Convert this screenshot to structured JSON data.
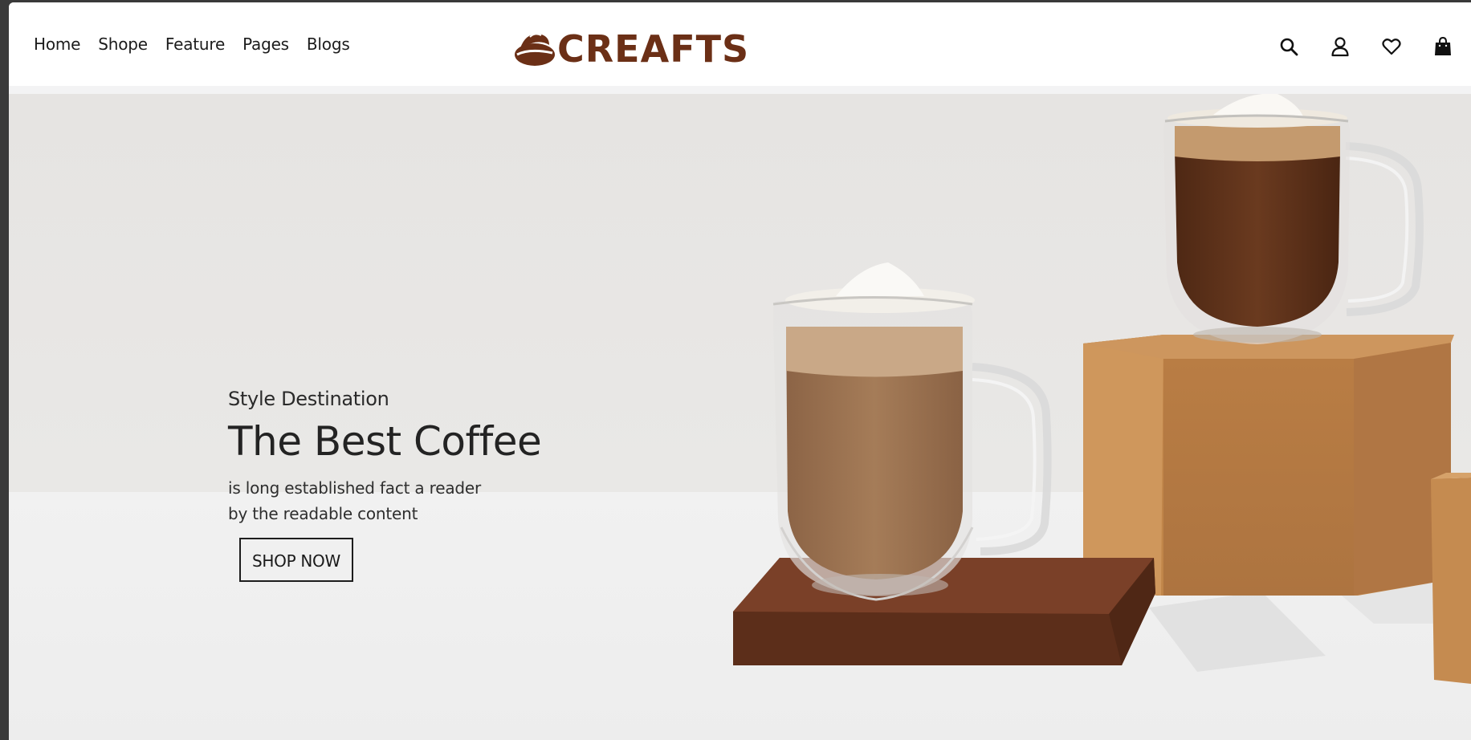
{
  "nav": {
    "items": [
      {
        "label": "Home"
      },
      {
        "label": "Shope"
      },
      {
        "label": "Feature"
      },
      {
        "label": "Pages"
      },
      {
        "label": "Blogs"
      }
    ]
  },
  "logo": {
    "text": "CREAFTS",
    "color": "#6b2f16"
  },
  "header_icons": [
    "search-icon",
    "user-icon",
    "heart-icon",
    "shopping-bag-icon"
  ],
  "hero": {
    "eyebrow": "Style Destination",
    "headline": "The Best Coffee",
    "description": "is long established fact a reader by the readable content",
    "cta_label": "SHOP NOW"
  },
  "colors": {
    "brand": "#6b2f16",
    "text": "#232323",
    "pedestal_tan": "#c68e52",
    "pedestal_dark": "#6e3a24"
  }
}
